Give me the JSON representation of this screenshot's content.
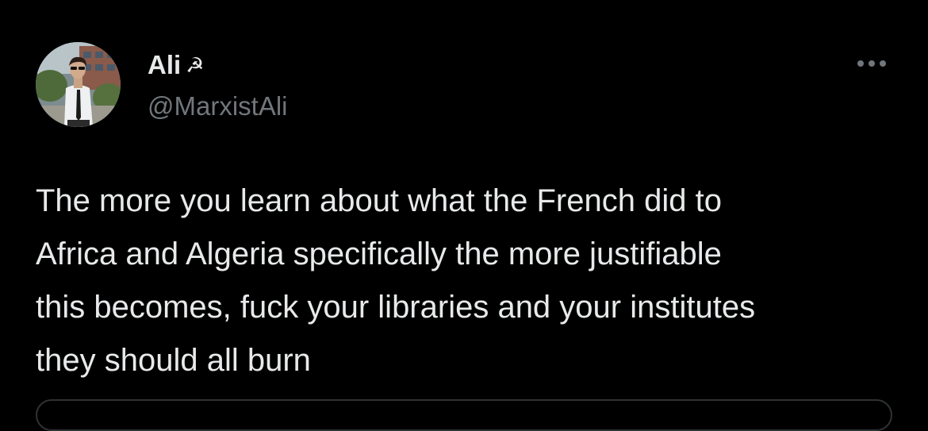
{
  "author": {
    "display_name": "Ali",
    "name_emoji": "☭",
    "handle": "@MarxistAli"
  },
  "tweet": {
    "text": "The more you learn about what the French did to\nAfrica and Algeria specifically the more justifiable\nthis becomes, fuck your libraries and your institutes\nthey should all burn"
  },
  "icons": {
    "more": "more-horizontal-icon",
    "avatar": "avatar-photo"
  },
  "colors": {
    "background": "#000000",
    "primary_text": "#e7e9ea",
    "secondary_text": "#71767b",
    "border": "#2f3336"
  }
}
